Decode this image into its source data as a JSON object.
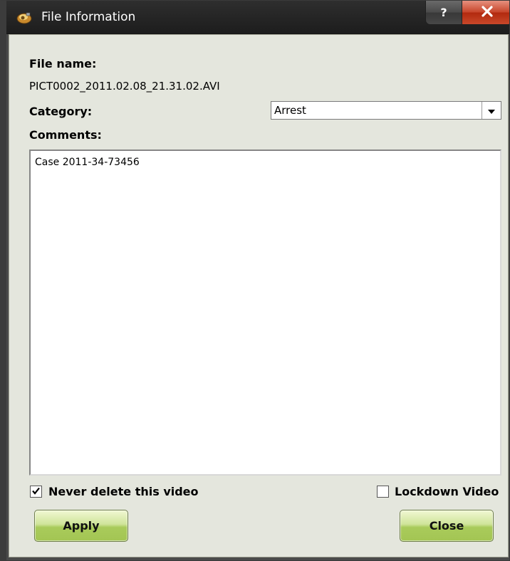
{
  "window": {
    "title": "File Information",
    "help_label": "?",
    "close_icon": "close-x-icon",
    "app_icon": "app-icon",
    "colors": {
      "titlebar": "#1d1d1d",
      "client_bg": "#e4e6dd",
      "close_button": "#c8462c",
      "button_green": "#a9cb5b"
    }
  },
  "form": {
    "file_name_label": "File name:",
    "file_name_value": "PICT0002_2011.02.08_21.31.02.AVI",
    "category_label": "Category:",
    "category_selected": "Arrest",
    "comments_label": "Comments:",
    "comments_value": "Case 2011-34-73456"
  },
  "options": {
    "never_delete_label": "Never delete this video",
    "never_delete_checked": true,
    "lockdown_label": "Lockdown Video",
    "lockdown_checked": false
  },
  "buttons": {
    "apply_label": "Apply",
    "close_label": "Close"
  }
}
